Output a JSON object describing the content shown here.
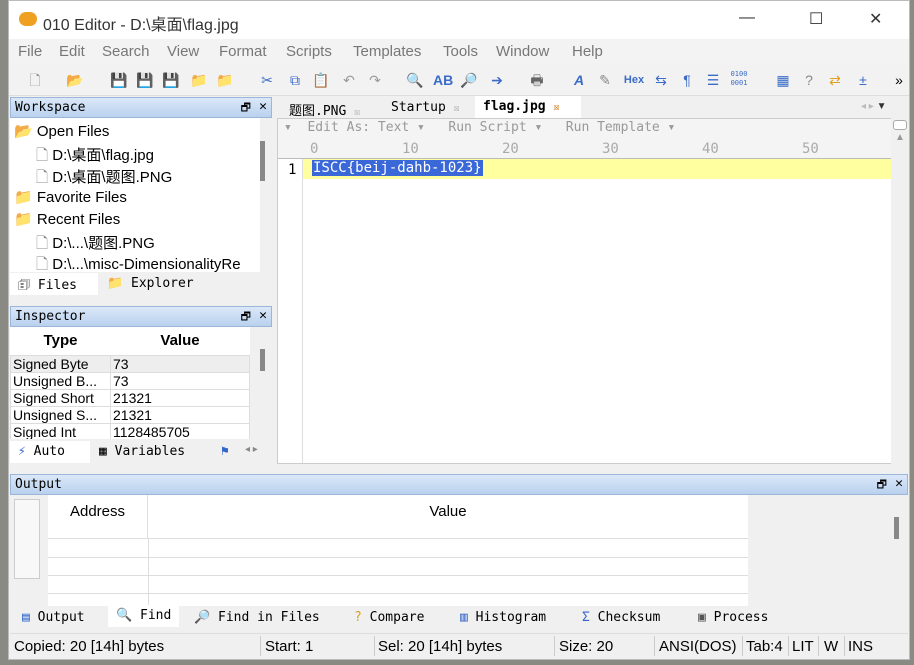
{
  "window": {
    "title": "010 Editor - D:\\桌面\\flag.jpg"
  },
  "menu": [
    "File",
    "Edit",
    "Search",
    "View",
    "Format",
    "Scripts",
    "Templates",
    "Tools",
    "Window",
    "Help"
  ],
  "toolbar": {
    "hex_label": "Hex",
    "binary_label": "0100\n0001",
    "overflow": "»"
  },
  "workspace": {
    "title": "Workspace",
    "tree": [
      {
        "label": "Open Files",
        "level": 0,
        "icon": "folder-open-icon"
      },
      {
        "label": "D:\\桌面\\flag.jpg",
        "level": 1,
        "icon": "file-icon"
      },
      {
        "label": "D:\\桌面\\题图.PNG",
        "level": 1,
        "icon": "file-icon"
      },
      {
        "label": "Favorite Files",
        "level": 0,
        "icon": "folder-star-icon"
      },
      {
        "label": "Recent Files",
        "level": 0,
        "icon": "folder-recent-icon"
      },
      {
        "label": "D:\\...\\题图.PNG",
        "level": 1,
        "icon": "file-icon"
      },
      {
        "label": "D:\\...\\misc-DimensionalityRe",
        "level": 1,
        "icon": "file-icon"
      }
    ],
    "tabs": [
      "Files",
      "Explorer"
    ]
  },
  "inspector": {
    "title": "Inspector",
    "headers": [
      "Type",
      "Value"
    ],
    "rows": [
      [
        "Signed Byte",
        "73"
      ],
      [
        "Unsigned B...",
        "73"
      ],
      [
        "Signed Short",
        "21321"
      ],
      [
        "Unsigned S...",
        "21321"
      ],
      [
        "Signed Int",
        "1128485705"
      ]
    ],
    "tabs": [
      "Auto",
      "Variables"
    ]
  },
  "editor": {
    "tabs": [
      "题图.PNG",
      "Startup",
      "flag.jpg"
    ],
    "active_tab": "flag.jpg",
    "edit_as": "Edit As: Text",
    "run_script": "Run Script",
    "run_template": "Run Template",
    "ruler": [
      "0",
      "10",
      "20",
      "30",
      "40",
      "50"
    ],
    "lines": [
      {
        "number": "1",
        "text": "ISCC{beij-dahb-1023}"
      }
    ]
  },
  "output": {
    "title": "Output",
    "headers": [
      "Address",
      "Value"
    ],
    "tabs": [
      "Output",
      "Find",
      "Find in Files",
      "Compare",
      "Histogram",
      "Checksum",
      "Process"
    ],
    "active_tab": "Find"
  },
  "status": {
    "copied": "Copied: 20 [14h] bytes",
    "start": "Start: 1",
    "sel": "Sel: 20 [14h] bytes",
    "size": "Size: 20",
    "encoding": "ANSI(DOS)",
    "tab": "Tab:4",
    "lit": "LIT",
    "w": "W",
    "ins": "INS"
  }
}
